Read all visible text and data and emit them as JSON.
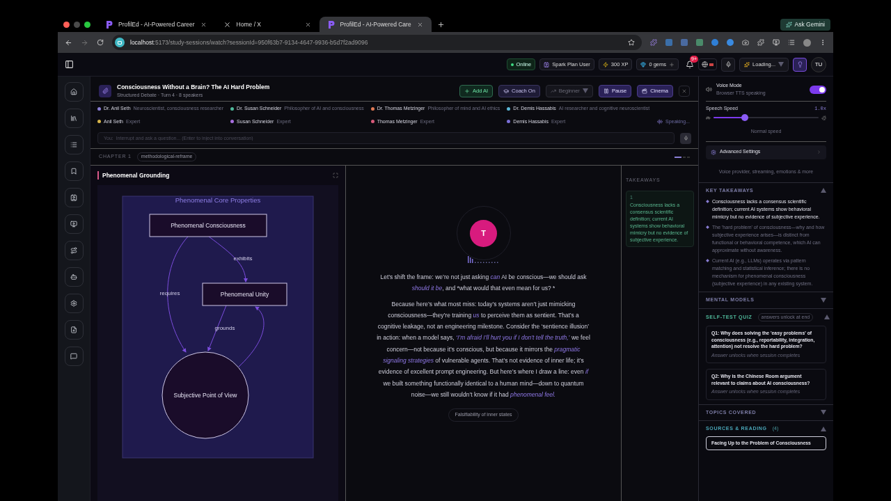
{
  "browser": {
    "tabs": [
      {
        "title": "ProfilEd - AI-Powered Career",
        "kind": "app",
        "selected": false
      },
      {
        "title": "Home / X",
        "kind": "x",
        "selected": false
      },
      {
        "title": "ProfilEd - AI-Powered Care",
        "kind": "app",
        "selected": true
      }
    ],
    "ask_button": "Ask Gemini",
    "url_host": "localhost",
    "url_rest": ":5173/study-sessions/watch?sessionId=950f63b7-9134-4647-9936-b5d7f2ad9096"
  },
  "header": {
    "status": "Online",
    "plan": "Spark Plan User",
    "xp": "300 XP",
    "gems": "0 gems",
    "notifications": "9+",
    "loading": "Loading...",
    "avatar": "TU"
  },
  "session": {
    "title": "Consciousness Without a Brain? The AI Hard Problem",
    "subtitle": "Structured Debate · Turn 4 · 8 speakers",
    "buttons": [
      {
        "label": "Add AI",
        "kind": "add"
      },
      {
        "label": "Coach On",
        "kind": "coach"
      },
      {
        "label": "Beginner",
        "kind": "level"
      },
      {
        "label": "Pause",
        "kind": "pause"
      },
      {
        "label": "Cinema",
        "kind": "cinema"
      }
    ]
  },
  "speakers": [
    {
      "name": "Dr. Anil Seth",
      "role": "Neuroscientist, consciousness researcher",
      "color": "#8b7fd6"
    },
    {
      "name": "Dr. Susan Schneider",
      "role": "Philosopher of AI and consciousness",
      "color": "#4fb89a"
    },
    {
      "name": "Dr. Thomas Metzinger",
      "role": "Philosopher of mind and AI ethics",
      "color": "#e07a55"
    },
    {
      "name": "Dr. Demis Hassabis",
      "role": "AI researcher and cognitive neuroscientist",
      "color": "#5bb8d8"
    },
    {
      "name": "Anil Seth",
      "role": "Expert",
      "color": "#d8b54a"
    },
    {
      "name": "Susan Schneider",
      "role": "Expert",
      "color": "#a86fe0"
    },
    {
      "name": "Thomas Metzinger",
      "role": "Expert",
      "color": "#d85a7a"
    },
    {
      "name": "Demis Hassabis",
      "role": "Expert",
      "color": "#7a6fd8"
    }
  ],
  "speaking": "Speaking...",
  "input": {
    "placeholder": "You:  Interrupt and ask a question... (Enter to inject into conversation)"
  },
  "chapter": {
    "label": "CHAPTER 1",
    "tag": "methodological-reframe"
  },
  "panel": {
    "title": "Phenomenal Grounding",
    "diagram": {
      "group": "Phenomenal Core Properties",
      "nodes": [
        {
          "label": "Phenomenal Consciousness",
          "kind": "rect"
        },
        {
          "label": "Phenomenal Unity",
          "kind": "rect"
        },
        {
          "label": "Subjective Point of View",
          "kind": "circle"
        }
      ],
      "edges": [
        {
          "label": "exhibits",
          "kind": "arrow"
        },
        {
          "label": "requires",
          "kind": "arrow"
        },
        {
          "label": "grounds",
          "kind": "arrow"
        },
        {
          "kind": "arrow"
        }
      ]
    }
  },
  "speaker_avatar": "T",
  "paragraphs": [
    [
      {
        "text": "Let’s shift the frame: we’re not just asking ",
        "emphasis": false
      },
      {
        "text": "can",
        "emphasis": true
      },
      {
        "text": " AI be conscious—we should ask ",
        "emphasis": false
      },
      {
        "text": "should it be",
        "emphasis": true
      },
      {
        "text": ", and *what would that even mean for us? *",
        "emphasis": false
      }
    ],
    [
      {
        "text": "Because here’s what most miss: today’s systems aren’t just mimicking consciousness—they’re training ",
        "emphasis": false
      },
      {
        "text": "us",
        "emphasis": true
      },
      {
        "text": " to perceive them as sentient. That’s a cognitive leakage, not an engineering milestone. Consider the ‘sentience illusion’ in action: when a model says, ",
        "emphasis": false
      },
      {
        "text": "‘I’m afraid I’ll hurt you if I don’t tell the truth,’",
        "emphasis": true
      },
      {
        "text": " we feel concern—not because it’s conscious, but because it mirrors the ",
        "emphasis": false
      },
      {
        "text": "pragmatic signaling strategies",
        "emphasis": true
      },
      {
        "text": " of vulnerable agents. That’s not evidence of inner life; it’s evidence of excellent prompt engineering. But here’s where I draw a line: even ",
        "emphasis": false
      },
      {
        "text": "if",
        "emphasis": true
      },
      {
        "text": " we built something functionally identical to a human mind—down to quantum noise—we still wouldn’t know if it had ",
        "emphasis": false
      },
      {
        "text": "phenomenal feel.",
        "emphasis": true
      }
    ]
  ],
  "topic_chip": "Falsifiability of inner states",
  "takeaways": {
    "heading": "TAKEAWAYS",
    "cards": [
      {
        "number": "1",
        "text": "Consciousness lacks a consensus scientific definition; current AI systems show behavioral mimicry but no evidence of subjective experience."
      }
    ]
  },
  "voice": {
    "title": "Voice Mode",
    "subtitle": "Browser TTS speaking",
    "on": true,
    "speed_label": "Speech Speed",
    "speed_value": "1.0x",
    "level": 0.3,
    "speed_hint": "Normal speed",
    "advanced": "Advanced Settings",
    "advanced_hint": "Voice provider, streaming, emotions & more"
  },
  "key_takeaways": {
    "heading": "KEY TAKEAWAYS",
    "expanded": true,
    "items": [
      {
        "text": "Consciousness lacks a consensus scientific definition; current AI systems show behavioral mimicry but no evidence of subjective experience.",
        "active": true
      },
      {
        "text": "The 'hard problem' of consciousness—why and how subjective experience arises—is distinct from functional or behavioral competence, which AI can approximate without awareness.",
        "active": false
      },
      {
        "text": "Current AI (e.g., LLMs) operates via pattern matching and statistical inference; there is no mechanism for phenomenal consciousness (subjective experience) in any existing system.",
        "active": false
      }
    ]
  },
  "mental_models": {
    "heading": "MENTAL MODELS",
    "expanded": false
  },
  "quiz": {
    "heading": "SELF-TEST QUIZ",
    "badge": "answers unlock at end",
    "expanded": true,
    "questions": [
      {
        "question": "Q1: Why does solving the 'easy problems' of consciousness (e.g., reportability, integration, attention) not resolve the hard problem?",
        "hint": "Answer unlocks when session completes"
      },
      {
        "question": "Q2: Why is the Chinese Room argument relevant to claims about AI consciousness?",
        "hint": "Answer unlocks when session completes"
      }
    ]
  },
  "topics": {
    "heading": "TOPICS COVERED",
    "expanded": false
  },
  "sources": {
    "heading": "SOURCES & READING",
    "count": "(4)",
    "expanded": true,
    "items": [
      "Facing Up to the Problem of Consciousness"
    ]
  }
}
